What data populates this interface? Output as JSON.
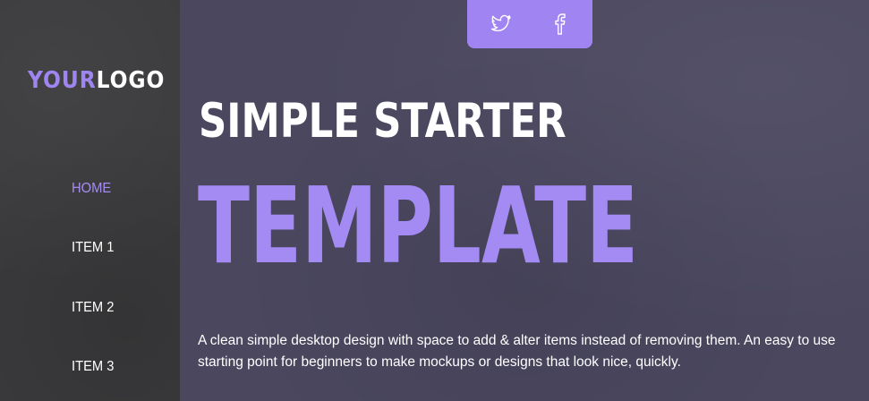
{
  "logo": {
    "accent": "YOUR",
    "rest": "LOGO"
  },
  "nav": {
    "items": [
      {
        "label": "HOME",
        "active": true
      },
      {
        "label": "ITEM 1",
        "active": false
      },
      {
        "label": "ITEM 2",
        "active": false
      },
      {
        "label": "ITEM 3",
        "active": false
      }
    ]
  },
  "social": {
    "icons": [
      "twitter-icon",
      "facebook-icon"
    ]
  },
  "hero": {
    "title_line1": "SIMPLE STARTER",
    "title_line2": "TEMPLATE",
    "description": "A clean simple desktop design with space to add & alter items instead of removing them. An easy to use starting point for beginners to make mockups or designs that look nice, quickly."
  },
  "colors": {
    "accent": "#a48bf3",
    "sidebar_bg": "#3b3b3d",
    "main_bg": "#4a475f",
    "text": "#ffffff"
  }
}
